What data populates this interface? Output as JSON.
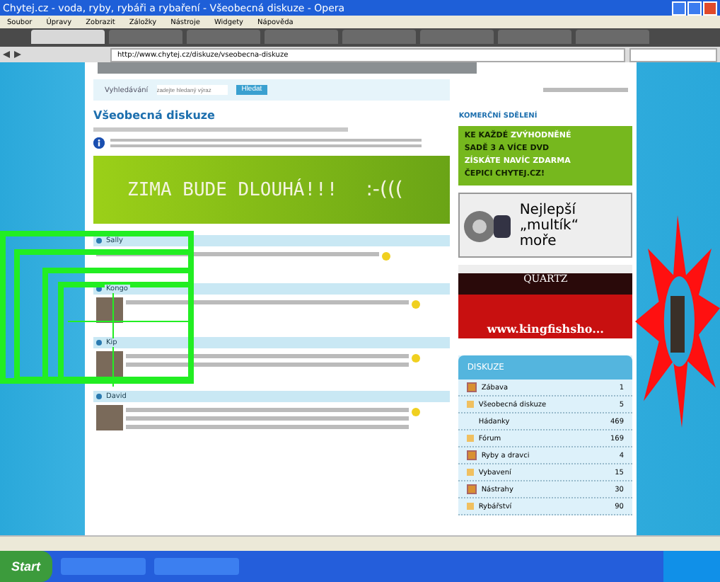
{
  "window": {
    "title": "Chytej.cz - voda, ryby, rybáři a rybaření - Všeobecná diskuze - Opera"
  },
  "menu": [
    "Soubor",
    "Úpravy",
    "Zobrazit",
    "Záložky",
    "Nástroje",
    "Widgety",
    "Nápověda"
  ],
  "tabs": [
    {
      "selected": true
    },
    {
      "selected": false
    },
    {
      "selected": false
    },
    {
      "selected": false
    },
    {
      "selected": false
    },
    {
      "selected": false
    },
    {
      "selected": false
    },
    {
      "selected": false
    }
  ],
  "address": {
    "value": "http://www.chytej.cz/diskuze/vseobecna-diskuze"
  },
  "search_bar": {
    "label": "Vyhledávání",
    "placeholder": "zadejte hledaný výraz",
    "button": "Hledat"
  },
  "forum": {
    "title": "Všeobecná diskuze",
    "banner": "ZIMA BUDE DLOUHÁ!!!",
    "smiley": ":-((("
  },
  "posts": [
    {
      "author": "Sally",
      "avatar": false
    },
    {
      "author": "Kongo",
      "avatar": true
    },
    {
      "author": "Kip",
      "avatar": true
    },
    {
      "author": "David",
      "avatar": true
    }
  ],
  "sidebar": {
    "heading": "KOMERČNÍ SDĚLENÍ",
    "promo": [
      "KE KAŽDÉ **ZVÝHODNĚNÉ**",
      "SADĚ 3 A VÍCE DVD",
      "**ZÍSKÁTE NAVÍC ZDARMA**",
      "ČEPICI CHYTEJ.CZ!"
    ],
    "reel_ad": [
      "Nejlepší",
      "„multík“",
      "moře"
    ],
    "brand_ad": {
      "brand": "QUARTZ",
      "url": "www.kingfishsho..."
    },
    "discussions": {
      "title": "DISKUZE",
      "items": [
        {
          "kind": "folder",
          "name": "Zábava",
          "count": "1"
        },
        {
          "kind": "open",
          "name": "Všeobecná diskuze",
          "count": "5",
          "children": [
            {
              "kind": "leaf",
              "name": "Hádanky",
              "count": "469"
            }
          ]
        },
        {
          "kind": "open",
          "name": "Fórum",
          "count": "169"
        },
        {
          "kind": "folder",
          "name": "Ryby a dravci",
          "count": "4"
        },
        {
          "kind": "open",
          "name": "Vybavení",
          "count": "15"
        },
        {
          "kind": "folder",
          "name": "Nástrahy",
          "count": "30"
        },
        {
          "kind": "open",
          "name": "Rybářství",
          "count": "90"
        }
      ]
    }
  },
  "taskbar": {
    "start": "Start"
  }
}
